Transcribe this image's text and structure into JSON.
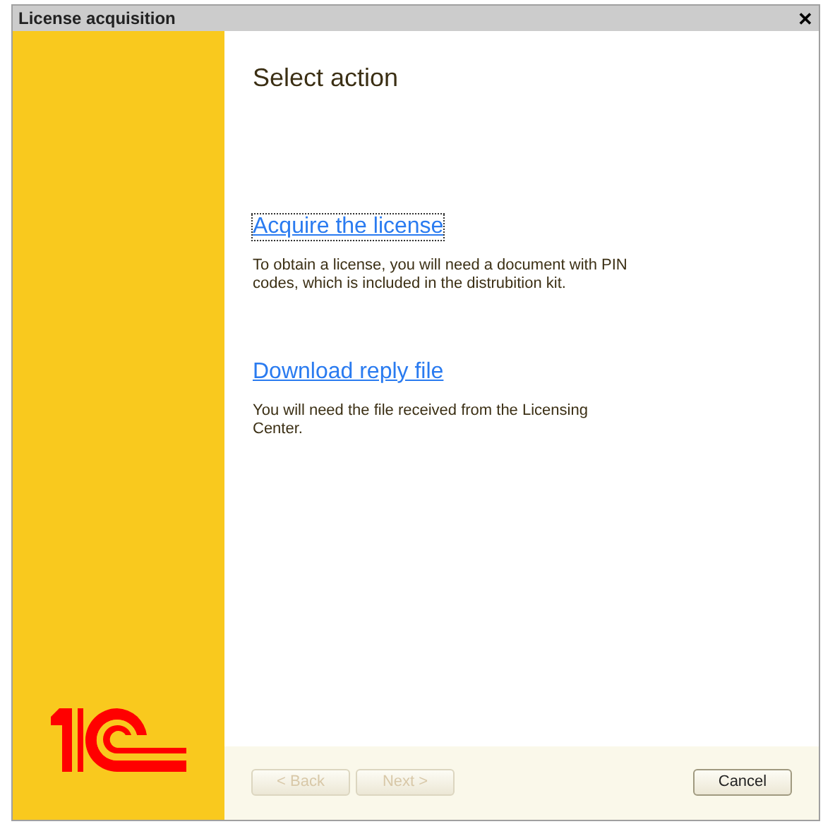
{
  "window": {
    "title": "License acquisition",
    "close": "✕"
  },
  "heading": "Select action",
  "actions": [
    {
      "link": "Acquire the license",
      "description": "To obtain a license, you will need a document with PIN codes, which is included in the distrubition kit.",
      "focused": true
    },
    {
      "link": "Download reply file",
      "description": "You will need the file received from the Licensing Center.",
      "focused": false
    }
  ],
  "buttons": [
    {
      "label": "< Back",
      "disabled": true
    },
    {
      "label": "Next >",
      "disabled": true
    },
    {
      "label": "Cancel",
      "disabled": false
    }
  ]
}
